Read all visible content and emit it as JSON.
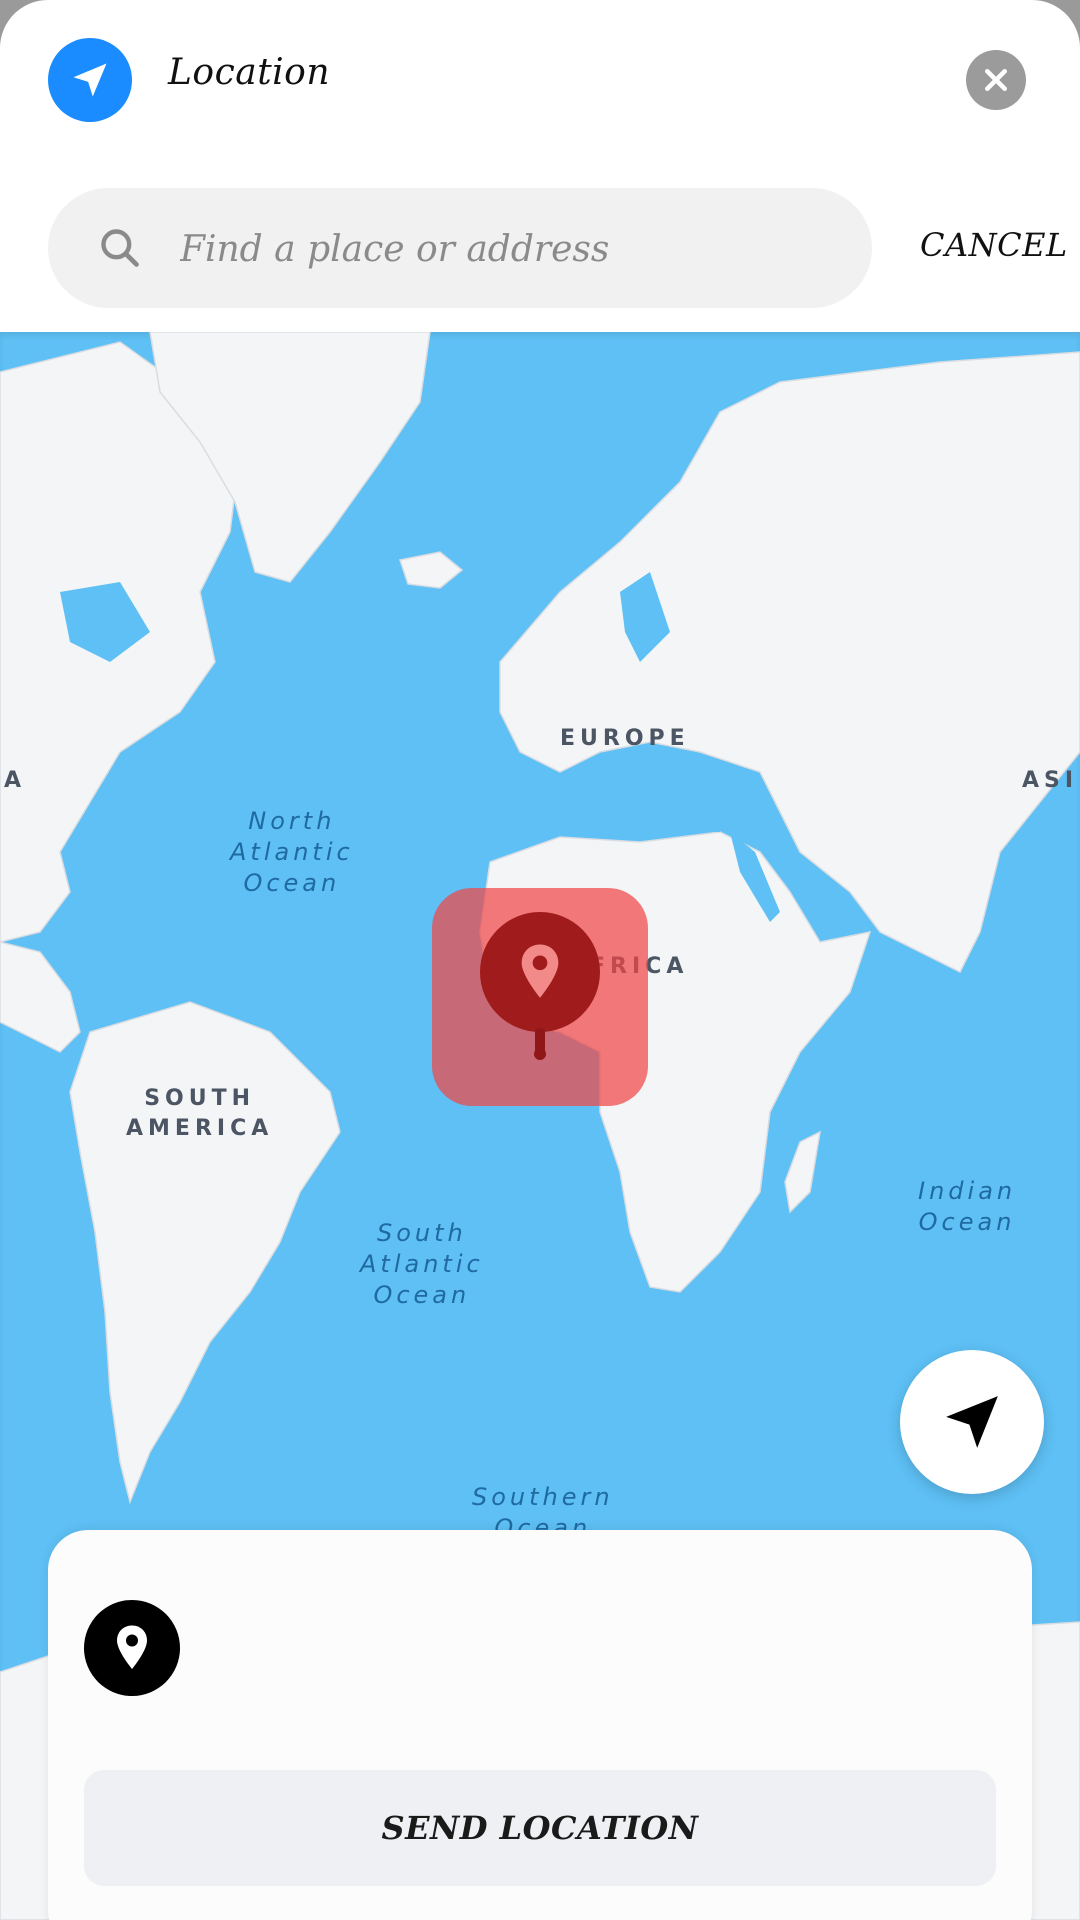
{
  "header": {
    "title": "Location",
    "location_icon": "navigation-arrow-icon",
    "close_icon": "close-icon",
    "accent_color": "#1a8cff"
  },
  "search": {
    "placeholder": "Find a place or address",
    "value": "",
    "icon": "search-icon",
    "cancel_label": "CANCEL"
  },
  "map": {
    "continents": [
      {
        "label": "EUROPE"
      },
      {
        "label": "AFRICA"
      },
      {
        "label": "SOUTH\nAMERICA"
      },
      {
        "label": "ASI"
      },
      {
        "label": "A"
      }
    ],
    "oceans": [
      {
        "label": "North\nAtlantic\nOcean"
      },
      {
        "label": "South\nAtlantic\nOcean"
      },
      {
        "label": "Indian\nOcean"
      },
      {
        "label": "Southern\nOcean"
      }
    ],
    "water_color": "#5ec0f5",
    "land_color": "#f4f5f6",
    "marker_icon": "map-pin-icon",
    "marker_color": "#a01c1c",
    "my_location_icon": "navigation-arrow-icon"
  },
  "card": {
    "pin_icon": "map-pin-icon",
    "address": "",
    "send_label": "SEND LOCATION"
  }
}
